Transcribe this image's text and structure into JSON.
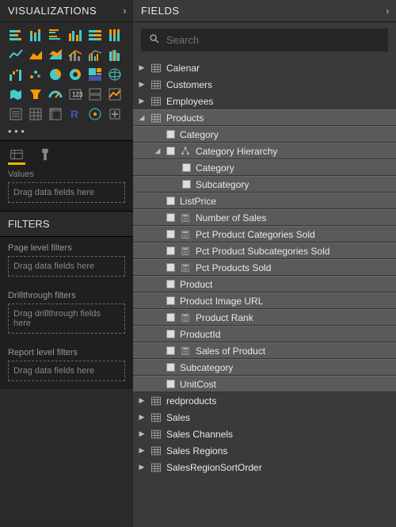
{
  "left": {
    "viz_title": "Visualizations",
    "fields_title": "Fields",
    "values_label": "Values",
    "values_placeholder": "Drag data fields here",
    "filters_title": "Filters",
    "filters": [
      {
        "label": "Page level filters",
        "placeholder": "Drag data fields here"
      },
      {
        "label": "Drillthrough filters",
        "placeholder": "Drag drillthrough fields here"
      },
      {
        "label": "Report level filters",
        "placeholder": "Drag data fields here"
      }
    ]
  },
  "search": {
    "placeholder": "Search"
  },
  "tree": [
    {
      "name": "Calenar",
      "icon": "table",
      "level": 0,
      "state": "collapsed"
    },
    {
      "name": "Customers",
      "icon": "table",
      "level": 0,
      "state": "collapsed"
    },
    {
      "name": "Employees",
      "icon": "table",
      "level": 0,
      "state": "collapsed"
    },
    {
      "name": "Products",
      "icon": "table",
      "level": 0,
      "state": "expanded",
      "highlight": true
    },
    {
      "name": "Category",
      "icon": "",
      "level": 1,
      "highlight": true
    },
    {
      "name": "Category Hierarchy",
      "icon": "hierarchy",
      "level": 1,
      "state": "expanded",
      "highlight": true
    },
    {
      "name": "Category",
      "icon": "",
      "level": 2,
      "highlight": true
    },
    {
      "name": "Subcategory",
      "icon": "",
      "level": 2,
      "highlight": true
    },
    {
      "name": "ListPrice",
      "icon": "",
      "level": 1,
      "highlight": true
    },
    {
      "name": "Number of Sales",
      "icon": "calc",
      "level": 1,
      "highlight": true
    },
    {
      "name": "Pct Product Categories Sold",
      "icon": "calc",
      "level": 1,
      "highlight": true
    },
    {
      "name": "Pct Product Subcategories Sold",
      "icon": "calc",
      "level": 1,
      "highlight": true
    },
    {
      "name": "Pct Products Sold",
      "icon": "calc",
      "level": 1,
      "highlight": true
    },
    {
      "name": "Product",
      "icon": "",
      "level": 1,
      "highlight": true
    },
    {
      "name": "Product Image URL",
      "icon": "",
      "level": 1,
      "highlight": true
    },
    {
      "name": "Product Rank",
      "icon": "calc",
      "level": 1,
      "highlight": true
    },
    {
      "name": "ProductId",
      "icon": "",
      "level": 1,
      "highlight": true
    },
    {
      "name": "Sales of Product",
      "icon": "calc",
      "level": 1,
      "highlight": true
    },
    {
      "name": "Subcategory",
      "icon": "",
      "level": 1,
      "highlight": true
    },
    {
      "name": "UnitCost",
      "icon": "",
      "level": 1,
      "highlight": true
    },
    {
      "name": "redproducts",
      "icon": "table",
      "level": 0,
      "state": "collapsed"
    },
    {
      "name": "Sales",
      "icon": "table",
      "level": 0,
      "state": "collapsed"
    },
    {
      "name": "Sales Channels",
      "icon": "table",
      "level": 0,
      "state": "collapsed"
    },
    {
      "name": "Sales Regions",
      "icon": "table",
      "level": 0,
      "state": "collapsed"
    },
    {
      "name": "SalesRegionSortOrder",
      "icon": "table",
      "level": 0,
      "state": "collapsed"
    }
  ]
}
